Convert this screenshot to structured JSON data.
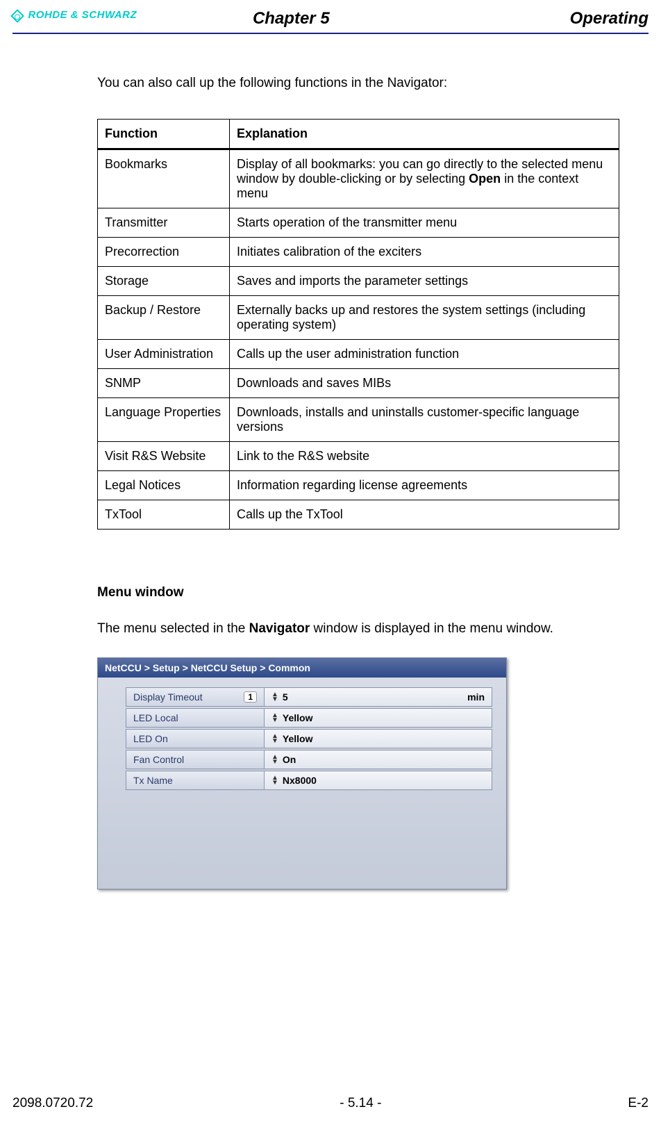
{
  "header": {
    "brand": "ROHDE & SCHWARZ",
    "chapter": "Chapter 5",
    "section": "Operating"
  },
  "intro": "You can also call up the following functions in the Navigator:",
  "table": {
    "head_function": "Function",
    "head_explanation": "Explanation",
    "rows": [
      {
        "func": "Bookmarks",
        "expl_pre": "Display of all bookmarks: you can go directly to the selected menu window by double-clicking or by selecting ",
        "expl_bold": "Open",
        "expl_post": " in the context menu"
      },
      {
        "func": "Transmitter",
        "expl": "Starts operation of the transmitter menu"
      },
      {
        "func": "Precorrection",
        "expl": "Initiates calibration of the exciters"
      },
      {
        "func": "Storage",
        "expl": "Saves and imports the parameter settings"
      },
      {
        "func": "Backup / Restore",
        "expl": "Externally backs up and restores the system settings (including operating system)"
      },
      {
        "func": "User Administration",
        "expl": "Calls up the user administration function"
      },
      {
        "func": "SNMP",
        "expl": "Downloads and saves MIBs"
      },
      {
        "func": "Language Properties",
        "expl": "Downloads, installs and uninstalls customer-specific language versions"
      },
      {
        "func": "Visit R&S Website",
        "expl": "Link to the R&S website"
      },
      {
        "func": "Legal Notices",
        "expl": "Information regarding license agreements"
      },
      {
        "func": "TxTool",
        "expl": "Calls up the TxTool"
      }
    ]
  },
  "menu_section": {
    "heading": "Menu window",
    "text_pre": "The menu selected in the ",
    "text_bold": "Navigator",
    "text_post": " window is displayed in the menu window."
  },
  "figure": {
    "titlebar": "NetCCU  > Setup > NetCCU Setup > Common",
    "rows": [
      {
        "label": "Display Timeout",
        "badge": "1",
        "value": "5",
        "unit": "min"
      },
      {
        "label": "LED Local",
        "value": "Yellow"
      },
      {
        "label": "LED On",
        "value": "Yellow"
      },
      {
        "label": "Fan Control",
        "value": "On"
      },
      {
        "label": "Tx Name",
        "value": "Nx8000"
      }
    ]
  },
  "footer": {
    "left": "2098.0720.72",
    "center": "- 5.14 -",
    "right": "E-2"
  }
}
